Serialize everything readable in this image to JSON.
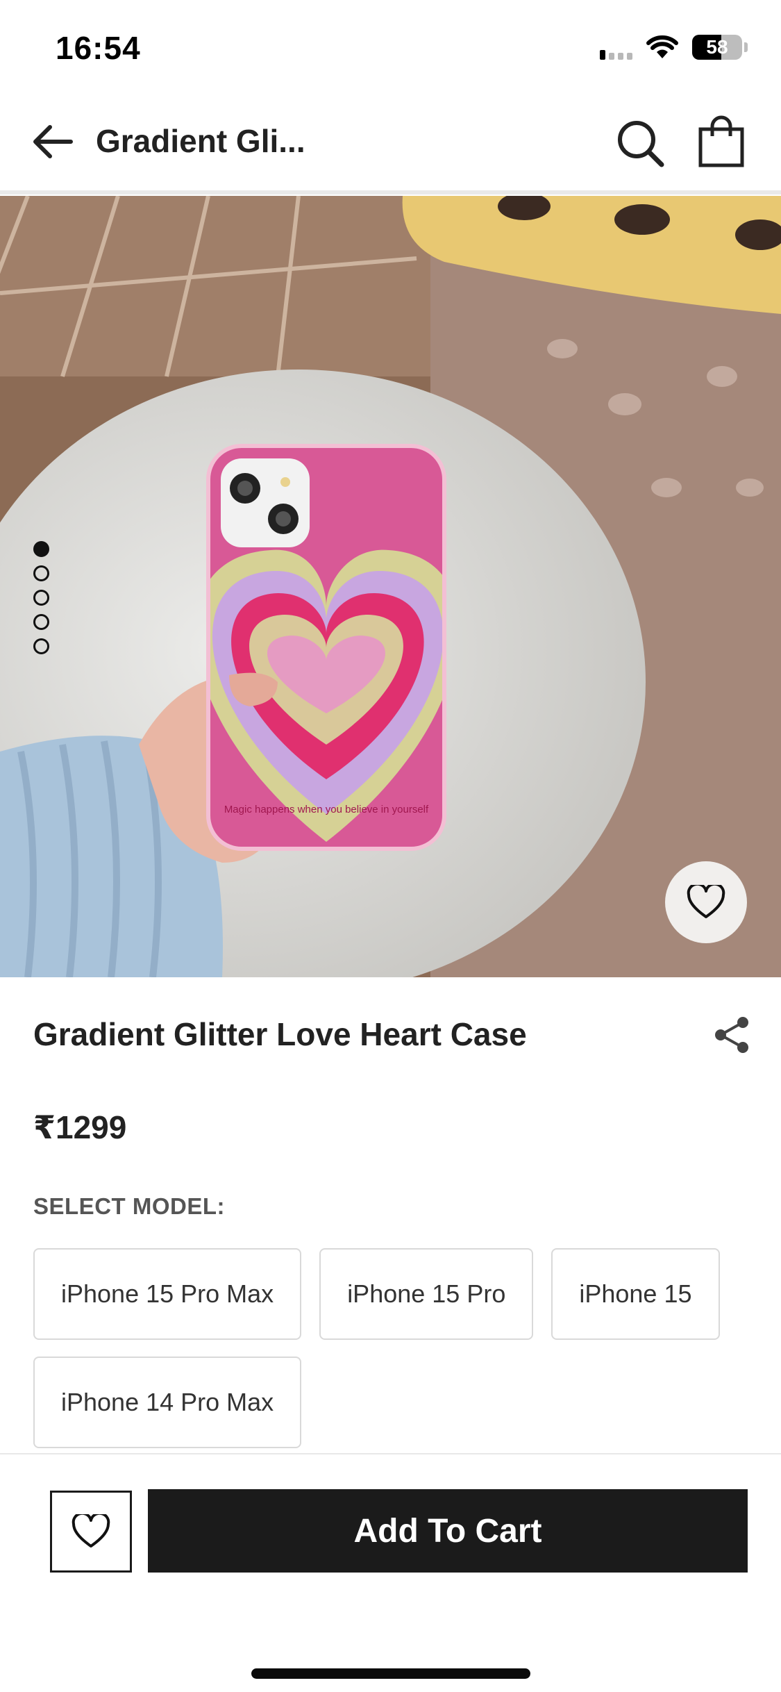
{
  "status_bar": {
    "time": "16:54",
    "battery": "58",
    "battery_level": 0.58
  },
  "header": {
    "title": "Gradient Gli...",
    "back_icon": "back-arrow-icon",
    "search_icon": "search-icon",
    "bag_icon": "shopping-bag-icon"
  },
  "gallery": {
    "total_images": 5,
    "active_index": 0
  },
  "product": {
    "title": "Gradient Glitter Love Heart Case",
    "price": "₹1299",
    "case_text": "Magic happens when you believe in yourself"
  },
  "model_select": {
    "label": "SELECT MODEL:",
    "options": [
      "iPhone 15 Pro Max",
      "iPhone 15 Pro",
      "iPhone 15",
      "iPhone 14 Pro Max"
    ]
  },
  "actions": {
    "add_to_cart": "Add To Cart"
  },
  "colors": {
    "primary": "#1b1b1b",
    "background": "#ffffff",
    "border": "#d9d9d9",
    "case_pink": "#e0306f",
    "case_lilac": "#c8a6e0"
  }
}
